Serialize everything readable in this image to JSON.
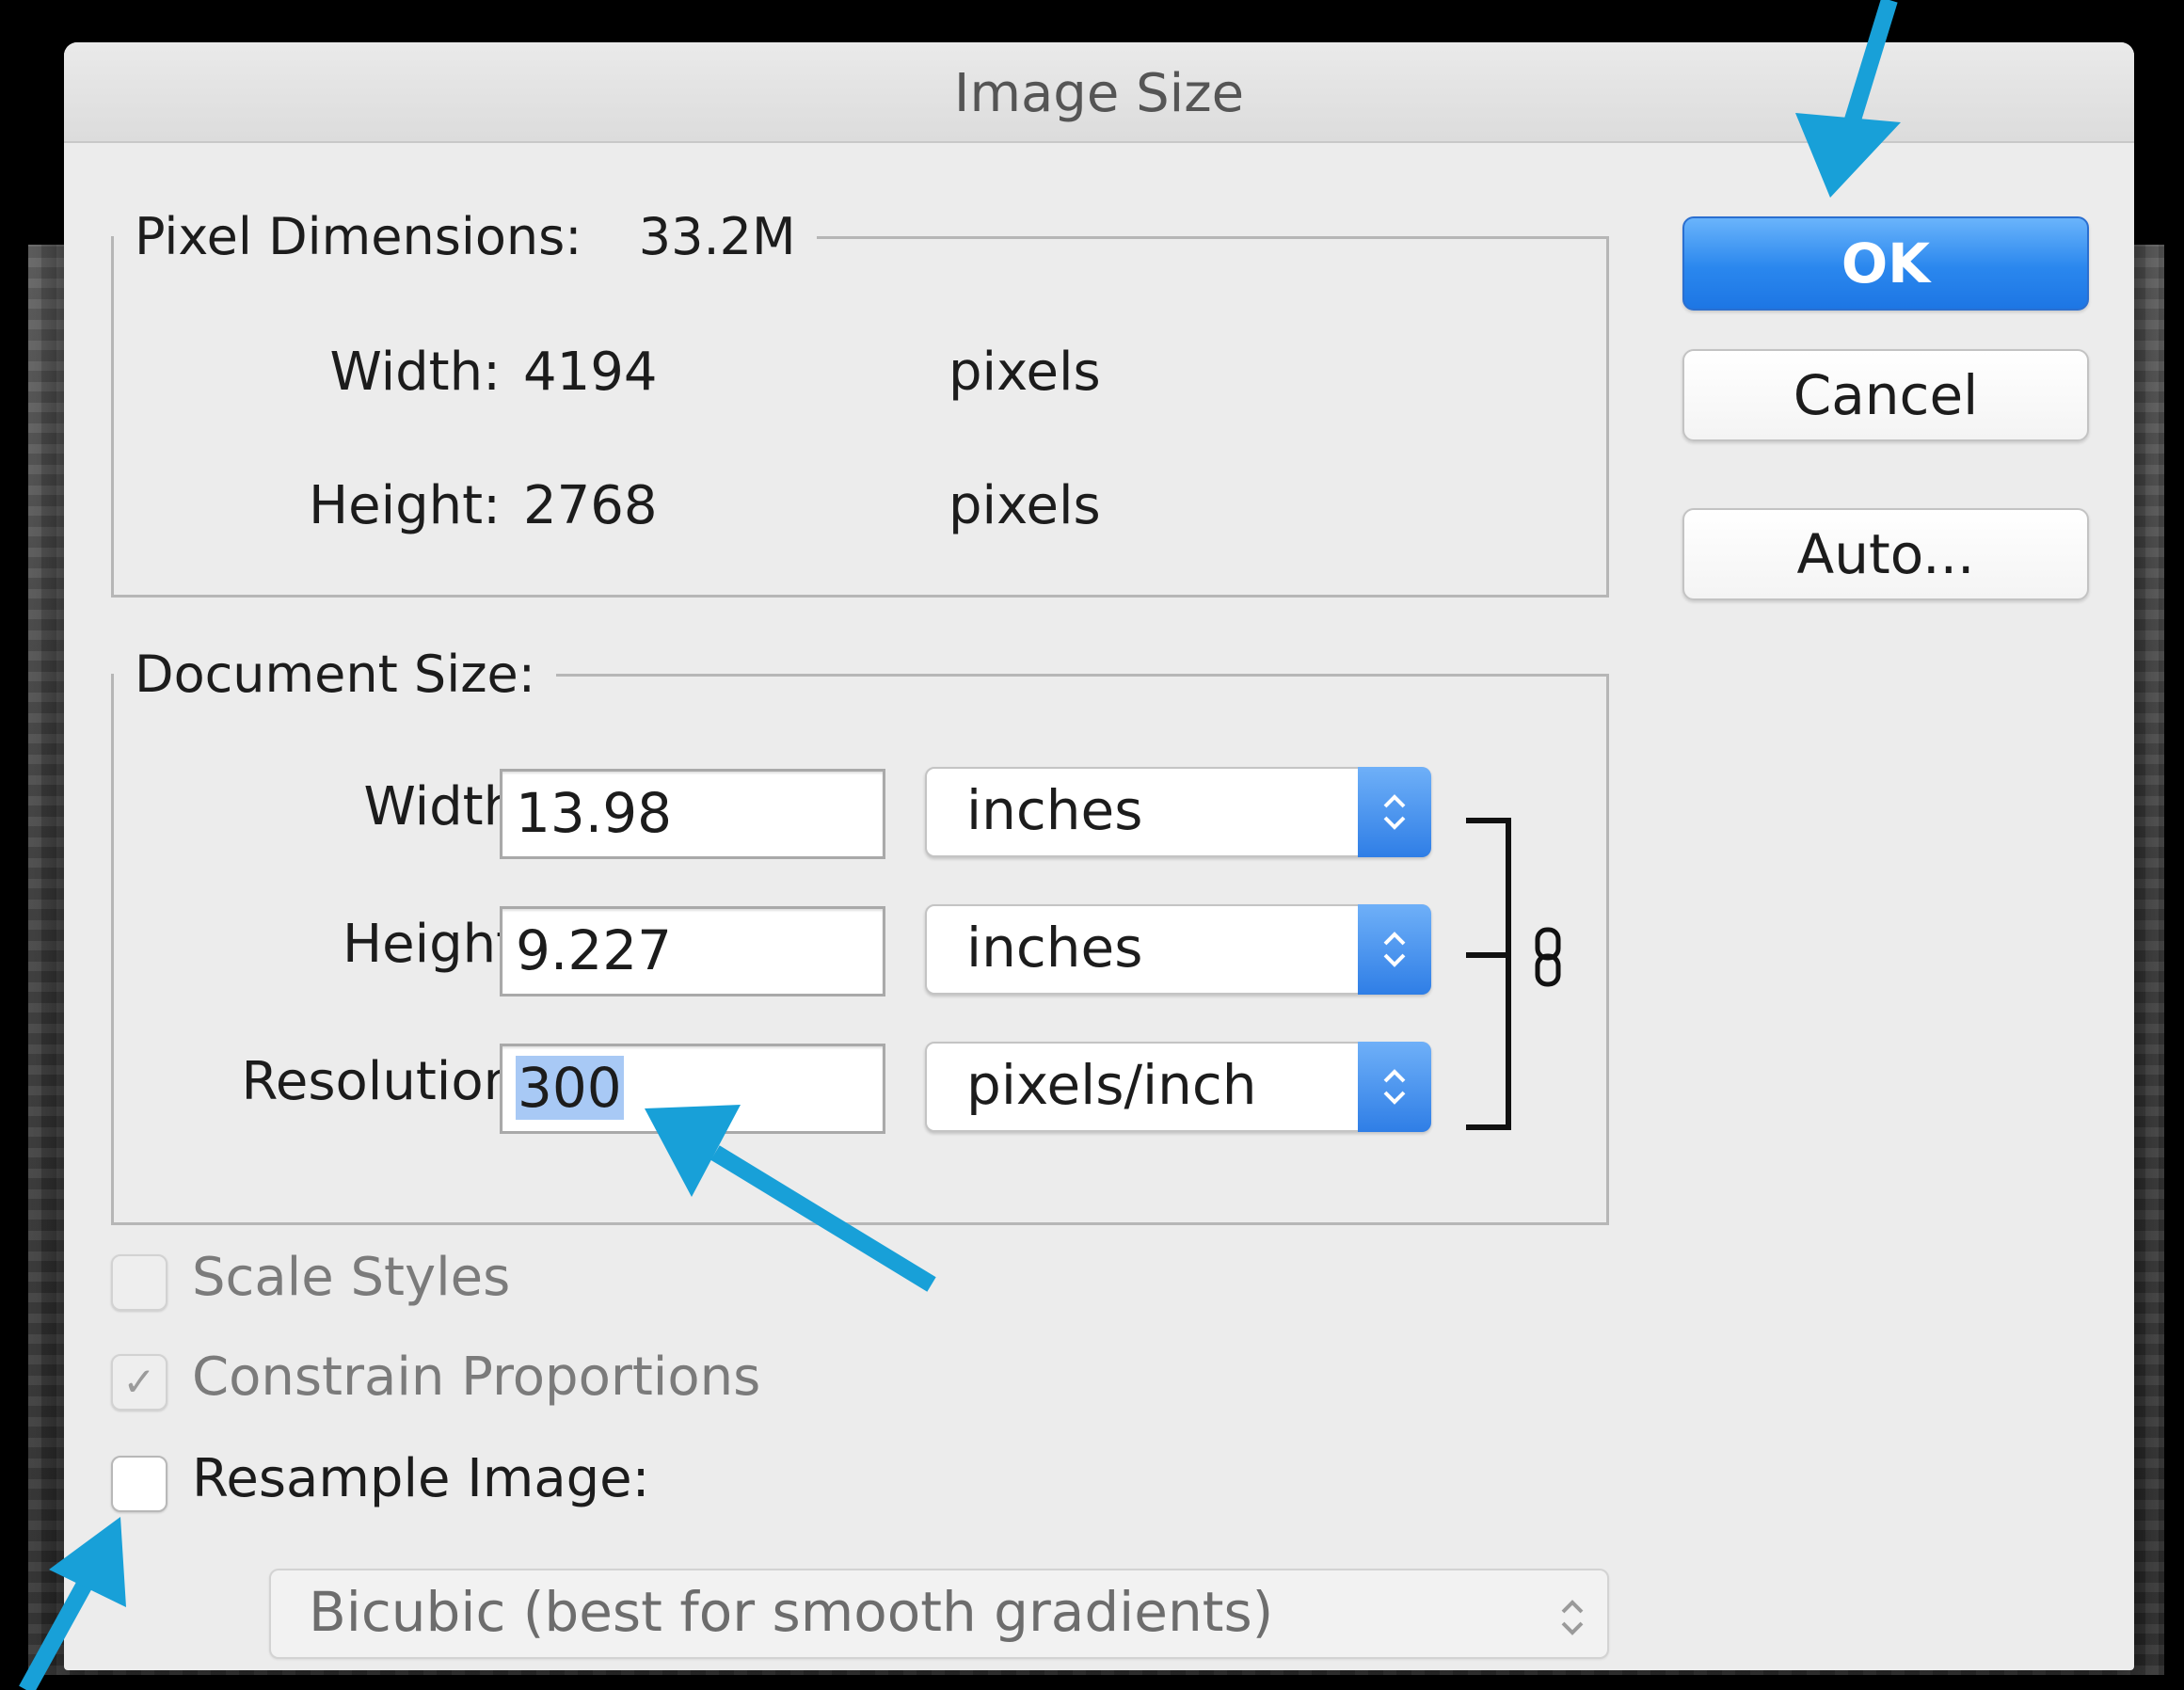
{
  "dialog": {
    "title": "Image Size",
    "buttons": {
      "ok": "OK",
      "cancel": "Cancel",
      "auto": "Auto..."
    }
  },
  "pixel_dimensions": {
    "legend": "Pixel Dimensions:",
    "size": "33.2M",
    "width_label": "Width:",
    "width_value": "4194",
    "width_unit": "pixels",
    "height_label": "Height:",
    "height_value": "2768",
    "height_unit": "pixels"
  },
  "document_size": {
    "legend": "Document Size:",
    "width_label": "Width:",
    "width_value": "13.98",
    "width_unit": "inches",
    "height_label": "Height:",
    "height_value": "9.227",
    "height_unit": "inches",
    "resolution_label": "Resolution:",
    "resolution_value": "300",
    "resolution_unit": "pixels/inch"
  },
  "options": {
    "scale_styles": {
      "label": "Scale Styles",
      "checked": false,
      "enabled": false
    },
    "constrain_proportions": {
      "label": "Constrain Proportions",
      "checked": true,
      "enabled": false
    },
    "resample_image": {
      "label": "Resample Image:",
      "checked": false,
      "enabled": true
    },
    "resample_method": "Bicubic (best for smooth gradients)"
  },
  "icons": {
    "stepper": "up-down-chevron-icon",
    "link": "chain-link-icon",
    "check": "checkmark-icon"
  },
  "colors": {
    "accent": "#2a87ee",
    "annotation_arrow": "#18a0d8",
    "dialog_bg": "#ececec"
  }
}
